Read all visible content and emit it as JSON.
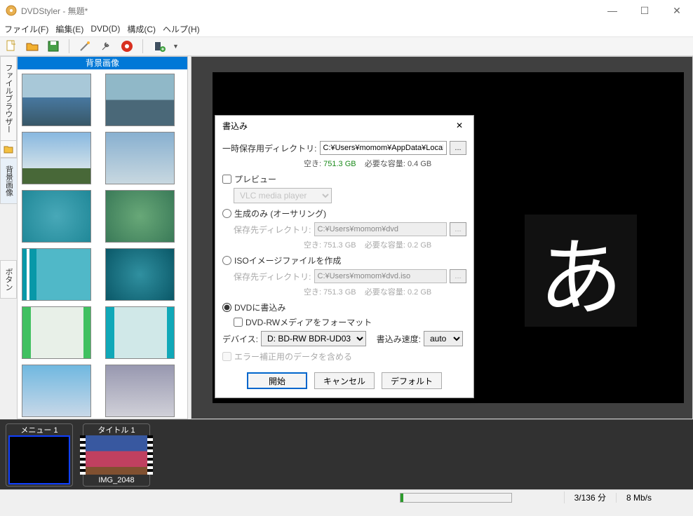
{
  "window": {
    "title": "DVDStyler - 無題*"
  },
  "menubar": [
    "ファイル(F)",
    "編集(E)",
    "DVD(D)",
    "構成(C)",
    "ヘルプ(H)"
  ],
  "side_tabs": {
    "browser": "ファイルブラウザー",
    "bg": "背景画像",
    "buttons": "ボタン"
  },
  "panel": {
    "header": "背景画像"
  },
  "timeline": {
    "menu_label": "メニュー 1",
    "title_label": "タイトル 1",
    "title_sub": "IMG_2048"
  },
  "statusbar": {
    "time": "3/136 分",
    "rate": "8 Mb/s"
  },
  "ime": "あ",
  "dialog": {
    "title": "書込み",
    "temp_label": "一時保存用ディレクトリ:",
    "temp_path": "C:¥Users¥momom¥AppData¥Local¥Temp",
    "free_label": "空き:",
    "free_val": "751.3 GB",
    "need_label": "必要な容量:",
    "need_val": "0.4 GB",
    "preview_label": "プレビュー",
    "preview_player": "VLC media player",
    "gen_label": "生成のみ (オーサリング)",
    "save_dir_label": "保存先ディレクトリ:",
    "gen_path": "C:¥Users¥momom¥dvd",
    "gen_need": "0.2 GB",
    "iso_label": "ISOイメージファイルを作成",
    "iso_path": "C:¥Users¥momom¥dvd.iso",
    "iso_need": "0.2 GB",
    "burn_label": "DVDに書込み",
    "format_label": "DVD-RWメディアをフォーマット",
    "device_label": "デバイス:",
    "device_val": "D: BD-RW   BDR-UD03",
    "speed_label": "書込み速度:",
    "speed_val": "auto",
    "ecc_label": "エラー補正用のデータを含める",
    "btn_start": "開始",
    "btn_cancel": "キャンセル",
    "btn_default": "デフォルト"
  }
}
